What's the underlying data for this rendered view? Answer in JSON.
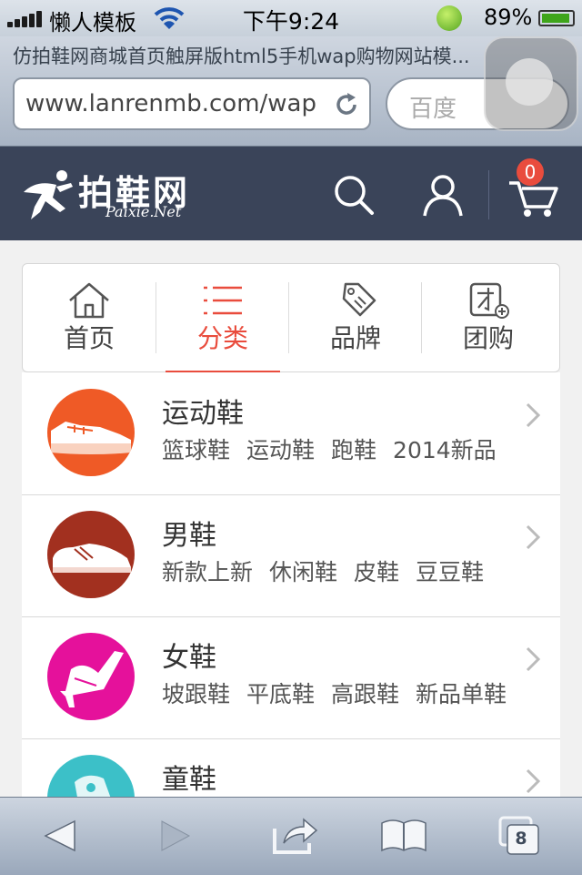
{
  "status_bar": {
    "carrier": "懒人模板",
    "time": "下午9:24",
    "battery_percent": "89%",
    "battery_level": 0.89
  },
  "browser": {
    "page_title": "仿拍鞋网商城首页触屏版html5手机wap购物网站模...",
    "url": "www.lanrenmb.com/wap",
    "search_placeholder": "百度",
    "open_tabs": "8"
  },
  "header": {
    "logo_text": "拍鞋网",
    "logo_subtext": "Paixie.Net",
    "cart_count": "0",
    "icons": [
      "search-icon",
      "user-icon",
      "cart-icon"
    ]
  },
  "nav": [
    {
      "label": "首页",
      "icon": "home-icon",
      "active": false
    },
    {
      "label": "分类",
      "icon": "list-icon",
      "active": true
    },
    {
      "label": "品牌",
      "icon": "tag-icon",
      "active": false
    },
    {
      "label": "团购",
      "icon": "group-buy-icon",
      "active": false
    }
  ],
  "categories": [
    {
      "name": "运动鞋",
      "tags": [
        "篮球鞋",
        "运动鞋",
        "跑鞋",
        "2014新品"
      ],
      "icon": "sneaker-icon",
      "color": "#ef5a26"
    },
    {
      "name": "男鞋",
      "tags": [
        "新款上新",
        "休闲鞋",
        "皮鞋",
        "豆豆鞋"
      ],
      "icon": "mens-shoe-icon",
      "color": "#a2301f"
    },
    {
      "name": "女鞋",
      "tags": [
        "坡跟鞋",
        "平底鞋",
        "高跟鞋",
        "新品单鞋"
      ],
      "icon": "high-heel-icon",
      "color": "#e5119b"
    },
    {
      "name": "童鞋",
      "tags": [],
      "icon": "kids-shoe-icon",
      "color": "#3cc0c8"
    }
  ],
  "colors": {
    "header_bg": "#3a4459",
    "accent": "#e94c3d"
  }
}
